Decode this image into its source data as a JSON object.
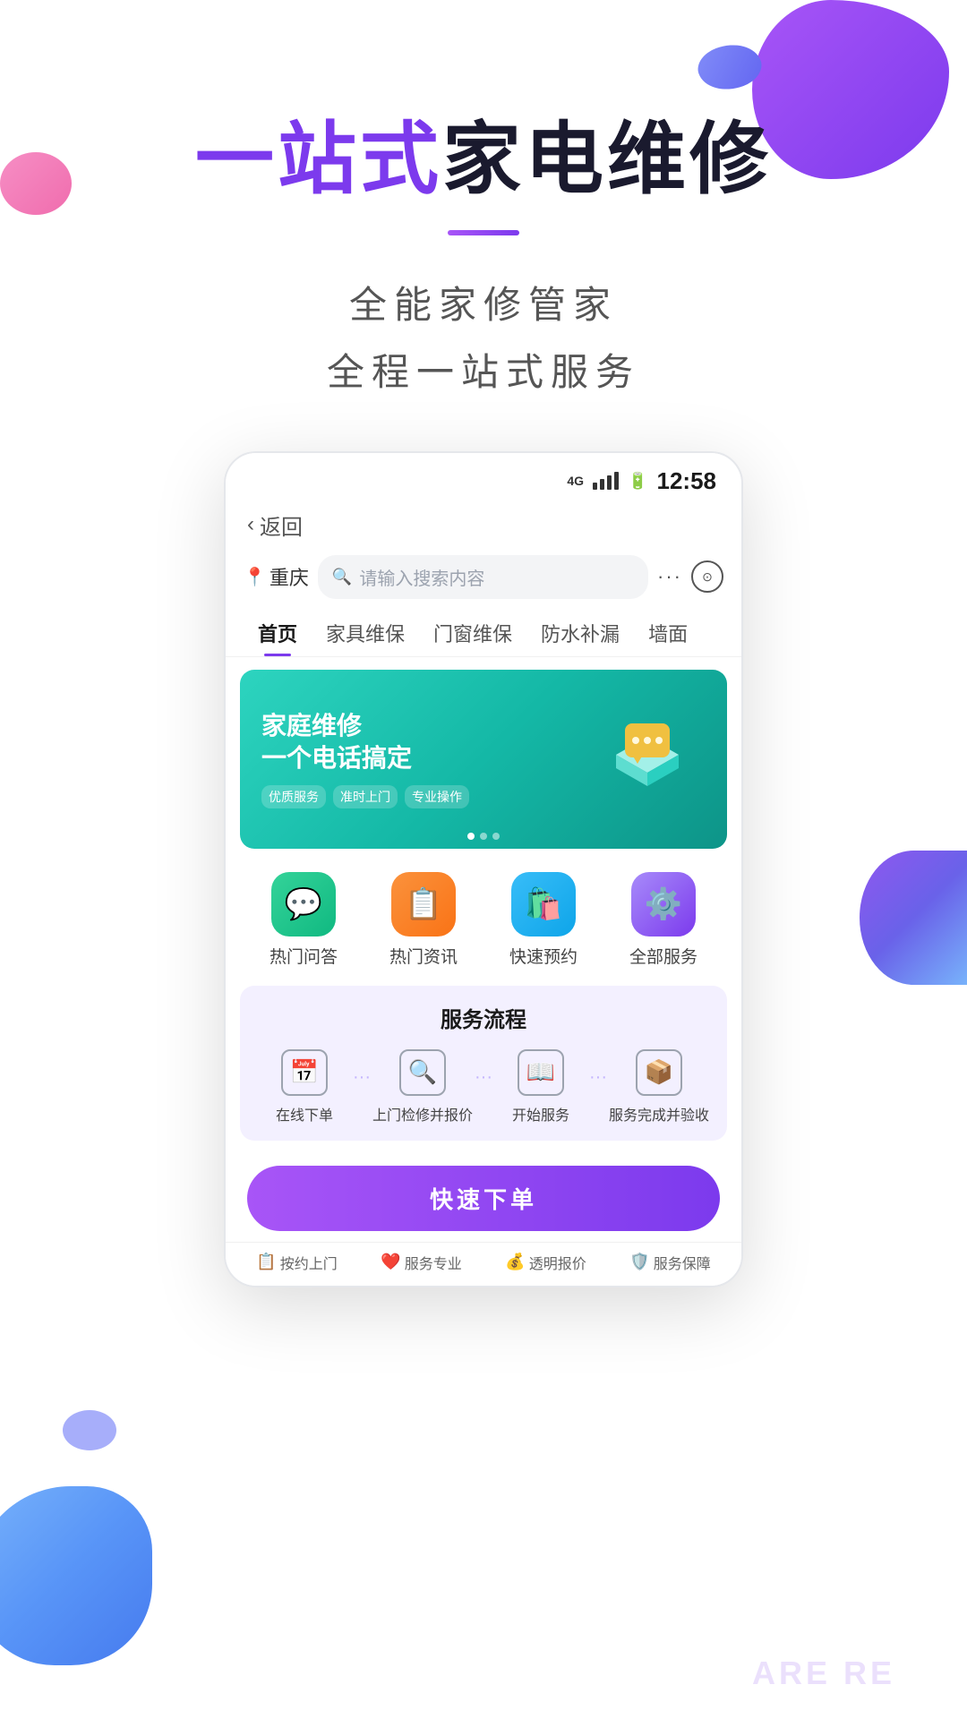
{
  "app": {
    "hero_title_highlight": "一站式",
    "hero_title_rest": "家电维修",
    "subtitle_line1": "全能家修管家",
    "subtitle_line2": "全程一站式服务"
  },
  "phone": {
    "status": {
      "network": "4G",
      "time": "12:58"
    },
    "back_label": "返回",
    "location": "重庆",
    "search_placeholder": "请输入搜索内容",
    "tabs": [
      {
        "label": "首页",
        "active": true
      },
      {
        "label": "家具维保",
        "active": false
      },
      {
        "label": "门窗维保",
        "active": false
      },
      {
        "label": "防水补漏",
        "active": false
      },
      {
        "label": "墙面",
        "active": false
      }
    ],
    "banner": {
      "title_line1": "家庭维修",
      "title_line2": "一个电话搞定",
      "badges": [
        "优质服务",
        "准时上门",
        "专业操作"
      ]
    },
    "quick_icons": [
      {
        "label": "热门问答",
        "icon": "💬",
        "color_class": "icon-green"
      },
      {
        "label": "热门资讯",
        "icon": "📋",
        "color_class": "icon-orange"
      },
      {
        "label": "快速预约",
        "icon": "🛍️",
        "color_class": "icon-blue"
      },
      {
        "label": "全部服务",
        "icon": "⚙️",
        "color_class": "icon-purple"
      }
    ],
    "service_flow": {
      "title": "服务流程",
      "steps": [
        {
          "icon": "📅",
          "label": "在线下单"
        },
        {
          "icon": "🔍",
          "label": "上门检修并报价"
        },
        {
          "icon": "📖",
          "label": "开始服务"
        },
        {
          "icon": "📦",
          "label": "服务完成并验收"
        }
      ]
    },
    "cta_label": "快速下单",
    "footer_items": [
      {
        "icon": "📋",
        "label": "按约上门"
      },
      {
        "icon": "❤️",
        "label": "服务专业"
      },
      {
        "icon": "💰",
        "label": "透明报价"
      },
      {
        "icon": "🛡️",
        "label": "服务保障"
      }
    ]
  },
  "bottom_watermark": "ARE RE"
}
